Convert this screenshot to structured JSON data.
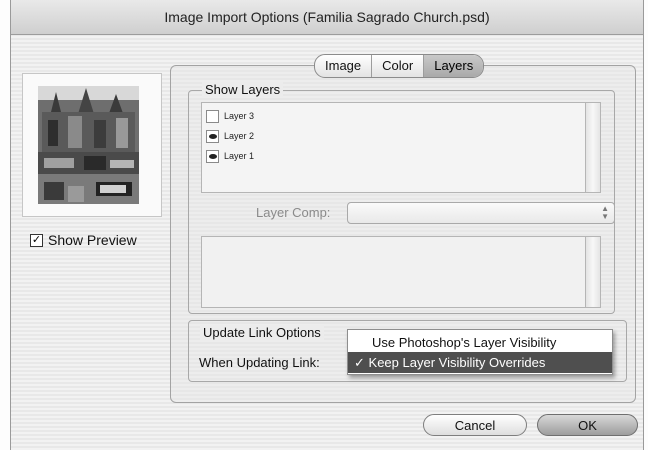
{
  "window": {
    "title": "Image Import Options (Familia Sagrado Church.psd)"
  },
  "preview": {
    "show_preview_label": "Show Preview",
    "show_preview_checked": true
  },
  "tabs": [
    {
      "label": "Image",
      "active": false
    },
    {
      "label": "Color",
      "active": false
    },
    {
      "label": "Layers",
      "active": true
    }
  ],
  "show_layers": {
    "label": "Show Layers",
    "layers": [
      {
        "name": "Layer 3",
        "visible": false
      },
      {
        "name": "Layer 2",
        "visible": true
      },
      {
        "name": "Layer 1",
        "visible": true
      }
    ]
  },
  "layer_comp": {
    "label": "Layer Comp:",
    "value": ""
  },
  "update_link": {
    "group_label": "Update Link Options",
    "when_label": "When Updating Link:",
    "options": [
      {
        "label": "Use Photoshop's Layer Visibility",
        "selected": false
      },
      {
        "label": "Keep Layer Visibility Overrides",
        "selected": true
      }
    ],
    "check_mark": "✓"
  },
  "buttons": {
    "cancel": "Cancel",
    "ok": "OK"
  },
  "icons": {
    "eye": "eye-icon",
    "checkbox": "checkbox-icon",
    "stepper": "updown-arrows-icon"
  }
}
